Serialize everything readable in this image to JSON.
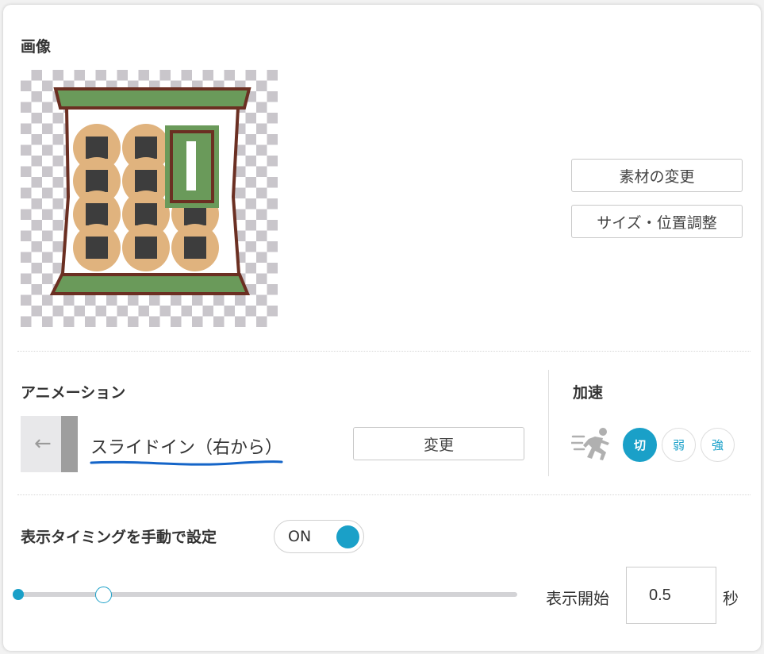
{
  "image_section": {
    "title": "画像",
    "change_material_label": "素材の変更",
    "size_position_label": "サイズ・位置調整"
  },
  "animation_section": {
    "title": "アニメーション",
    "current_animation": "スライドイン（右から）",
    "change_label": "変更"
  },
  "acceleration_section": {
    "title": "加速",
    "options": [
      "切",
      "弱",
      "強"
    ],
    "selected": "切"
  },
  "timing_section": {
    "title": "表示タイミングを手動で設定",
    "toggle_label": "ON",
    "toggle_on": true,
    "start_label": "表示開始",
    "start_value": "0.5",
    "unit": "秒"
  },
  "colors": {
    "accent": "#1aa0c8",
    "underline": "#1565c8",
    "bag_green": "#6a9a5a",
    "bag_outline": "#6b2f22",
    "cracker": "#e0b37e",
    "seaweed": "#3d3d3d"
  },
  "icons": {
    "preview_arrow": "arrow-left-icon",
    "runner": "running-person-icon"
  }
}
